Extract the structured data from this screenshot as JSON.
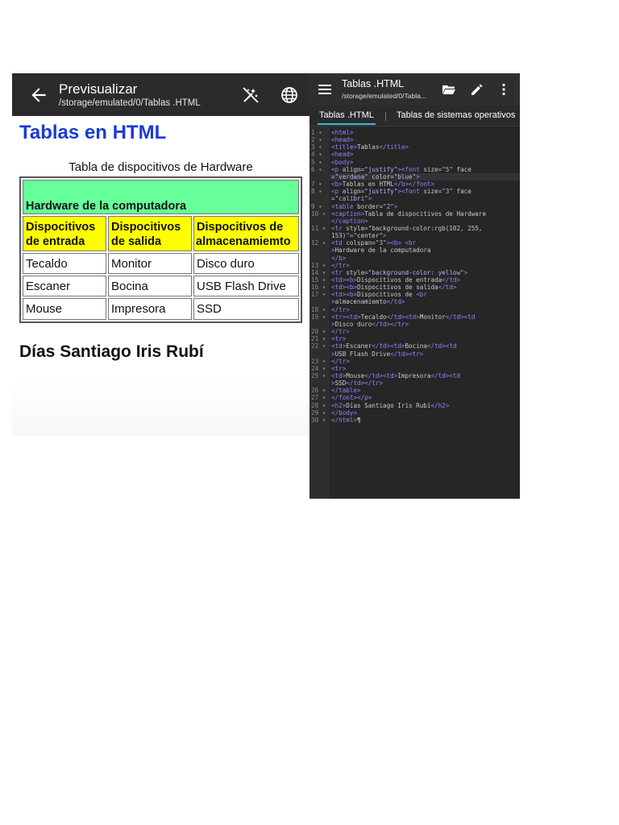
{
  "preview": {
    "title": "Previsualizar",
    "path": "/storage/emulated/0/Tablas .HTML",
    "back_icon": "arrow-left-icon",
    "icons": [
      "magic-wand-off-icon",
      "globe-icon"
    ],
    "heading": "Tablas en HTML",
    "heading_color": "#1a3bd6",
    "caption": "Tabla de dispocitivos de Hardware",
    "table": {
      "header_row": "Hardware de la computadora",
      "header_color": "#66ff99",
      "subheader_color": "#ffff00",
      "columns": [
        [
          "Dispocitivos",
          "de entrada"
        ],
        [
          "Dispocitivos",
          "de salida"
        ],
        [
          "Dispocitivos de",
          "almacenamiemto"
        ]
      ],
      "rows": [
        [
          "Tecaldo",
          "Monitor",
          "Disco duro"
        ],
        [
          "Escaner",
          "Bocina",
          "USB Flash Drive"
        ],
        [
          "Mouse",
          "Impresora",
          "SSD"
        ]
      ]
    },
    "subtitle": "Días Santiago Iris Rubí"
  },
  "editor": {
    "title": "Tablas .HTML",
    "path": "/storage/emulated/0/Tabla...",
    "icons": [
      "menu-icon",
      "folder-open-icon",
      "pencil-icon",
      "more-vert-icon"
    ],
    "tabs": [
      "Tablas .HTML",
      "Tablas de sistemas operativos"
    ],
    "lines": [
      {
        "n": "1",
        "c": "<html>"
      },
      {
        "n": "2",
        "c": "<head>"
      },
      {
        "n": "3",
        "c": "<title>Tablas</title>"
      },
      {
        "n": "4",
        "c": "<head>"
      },
      {
        "n": "5",
        "c": "<body>"
      },
      {
        "n": "6",
        "c": "<p align=\"justify\"><font size=\"5\" face"
      },
      {
        "n": "",
        "c": "     =\"verdana\" color=\"blue\">"
      },
      {
        "n": "7",
        "c": "  <b>Tablas en HTML</b></font>"
      },
      {
        "n": "8",
        "c": "<p align=\"justify\"><font size=\"3\" face"
      },
      {
        "n": "",
        "c": "     =\"calibri\">"
      },
      {
        "n": "9",
        "c": "<table border=\"2\">"
      },
      {
        "n": "10",
        "c": "<caption>Tabla de dispocitivos de Hardware"
      },
      {
        "n": "",
        "c": "     </caption>"
      },
      {
        "n": "11",
        "c": "<tr style=\"background-color:rgb(102, 255,"
      },
      {
        "n": "",
        "c": "     153)\"=\"center\">"
      },
      {
        "n": "12",
        "c": "          <td colspan=\"3\"><b> <br"
      },
      {
        "n": "",
        "c": "               >Hardware de la computadora"
      },
      {
        "n": "",
        "c": "               </b>"
      },
      {
        "n": "13",
        "c": "</tr>"
      },
      {
        "n": "14",
        "c": "<tr style=\"background-color: yellow\">"
      },
      {
        "n": "15",
        "c": "      <td><b>Dispocitivos de entrada</td>"
      },
      {
        "n": "16",
        "c": "      <td><b>Dispocitivos de salida</td>"
      },
      {
        "n": "17",
        "c": "      <td><b>Dispocitivos de <br"
      },
      {
        "n": "",
        "c": "          >almacenamiemto</td>"
      },
      {
        "n": "18",
        "c": "</tr>"
      },
      {
        "n": "19",
        "c": "<tr><td>Tecaldo</td><td>Monitor</td><td"
      },
      {
        "n": "",
        "c": "     >Disco duro</td></tr>"
      },
      {
        "n": "20",
        "c": "</tr>"
      },
      {
        "n": "21",
        "c": "<tr>"
      },
      {
        "n": "22",
        "c": "      <td>Escaner</td><td>Bocina</td><td"
      },
      {
        "n": "",
        "c": "          >USB Flash Drive</td><tr>"
      },
      {
        "n": "23",
        "c": "</tr>"
      },
      {
        "n": "24",
        "c": "<tr>"
      },
      {
        "n": "25",
        "c": "      <td>Mouse</td><td>Impresora</td><td"
      },
      {
        "n": "",
        "c": "          >SSD</td></tr>"
      },
      {
        "n": "26",
        "c": "</table>"
      },
      {
        "n": "27",
        "c": "</font></p>"
      },
      {
        "n": "28",
        "c": "<h2>Días Santiago Iris Rubí</h2>"
      },
      {
        "n": "29",
        "c": "</body>"
      },
      {
        "n": "30",
        "c": "</html>¶"
      }
    ]
  }
}
